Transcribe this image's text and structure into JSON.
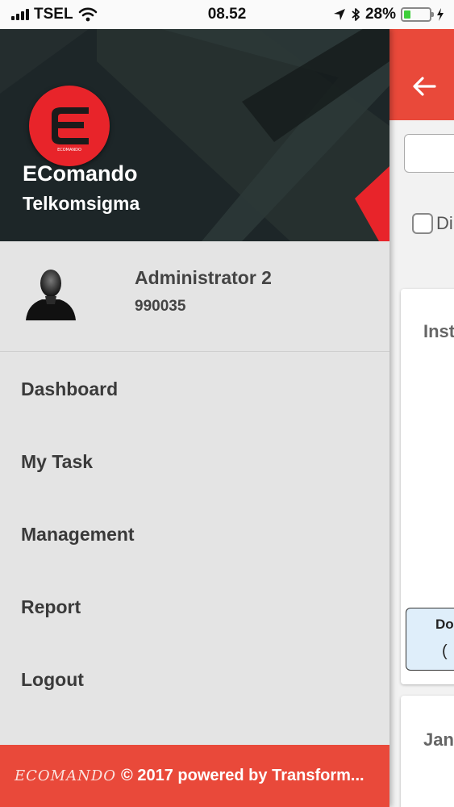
{
  "status_bar": {
    "carrier": "TSEL",
    "time": "08.52",
    "battery_percent": "28%",
    "battery_level": 0.28,
    "icons": [
      "signal-icon",
      "wifi-icon",
      "location-arrow-icon",
      "bluetooth-icon",
      "battery-icon",
      "charging-icon"
    ]
  },
  "drawer": {
    "header": {
      "logo_icon": "ecomando-logo-icon",
      "logo_caption": "ECOMANDO",
      "app_name": "EComando",
      "company": "Telkomsigma"
    },
    "profile": {
      "avatar_icon": "user-avatar-icon",
      "name": "Administrator 2",
      "id": "990035"
    },
    "menu": [
      {
        "label": "Dashboard"
      },
      {
        "label": "My Task"
      },
      {
        "label": "Management"
      },
      {
        "label": "Report"
      },
      {
        "label": "Logout"
      }
    ],
    "footer": {
      "brand": "ECOMANDO",
      "text": "© 2017 powered by Transform..."
    }
  },
  "background_app": {
    "back_icon": "arrow-left-icon",
    "checkbox_label": "Di",
    "card_title": "Inst",
    "card_inner_line1": "Do",
    "card_inner_line2": "(",
    "card2_title": "Jan"
  },
  "colors": {
    "accent": "#e9493a",
    "logo_red": "#e8242a",
    "header_dark": "#1d2628",
    "drawer_bg": "#e4e4e4",
    "battery_green": "#3ecf3a"
  }
}
